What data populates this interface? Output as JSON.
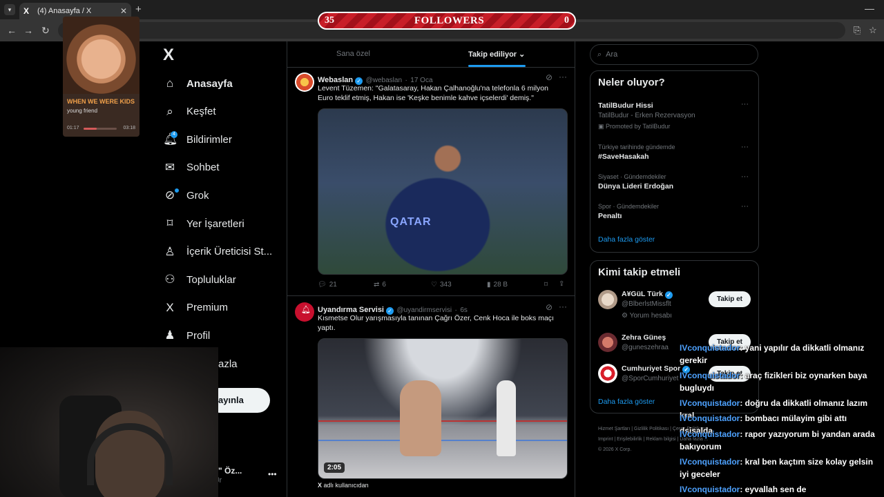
{
  "browser": {
    "tab_title": "(4) Anasayfa / X",
    "tab_favicon": "X",
    "tab_close": "✕",
    "new_tab": "+",
    "minimize": "—"
  },
  "followers_bar": {
    "left_count": "35",
    "label": "FOLLOWERS",
    "right_count": "0"
  },
  "music": {
    "song": "WHEN WE WERE KIDS",
    "artist": "young friend",
    "elapsed": "01:17",
    "total": "03:18",
    "progress": 0.39
  },
  "nav": {
    "logo": "X",
    "items": [
      {
        "label": "Anasayfa",
        "icon": "home-icon"
      },
      {
        "label": "Keşfet",
        "icon": "search-icon"
      },
      {
        "label": "Bildirimler",
        "icon": "bell-icon"
      },
      {
        "label": "Sohbet",
        "icon": "mail-icon"
      },
      {
        "label": "Grok",
        "icon": "grok-icon"
      },
      {
        "label": "Yer İşaretleri",
        "icon": "bookmark-icon"
      },
      {
        "label": "İçerik Üreticisi St...",
        "icon": "creator-icon"
      },
      {
        "label": "Topluluklar",
        "icon": "communities-icon"
      },
      {
        "label": "Premium",
        "icon": "x-icon"
      },
      {
        "label": "Profil",
        "icon": "profile-icon"
      },
      {
        "label": "azla",
        "icon": "more-icon"
      }
    ],
    "notification_count": "4",
    "post_button": "ayınla",
    "account_name": "elario\" Öz...",
    "account_handle": "Jr",
    "account_more": "•••"
  },
  "timeline": {
    "tabs": [
      "Sana özel",
      "Takip ediliyor"
    ],
    "active_tab": "Takip ediliyor",
    "posts": [
      {
        "name": "Webaslan",
        "handle": "@webaslan",
        "date": "17 Oca",
        "text": "Levent Tüzemen: \"Galatasaray, Hakan Çalhanoğlu'na telefonla 6 milyon Euro teklif etmiş, Hakan ise 'Keşke benimle kahve içselerdi' demiş.\"",
        "image_text": "QATAR",
        "replies": "21",
        "reposts": "6",
        "likes": "343",
        "views": "28 B"
      },
      {
        "name": "Uyandırma Servisi",
        "handle": "@uyandirmservisi",
        "date": "6s",
        "text": "Kısmetse Olur yarışmasıyla tanınan Çağrı Özer, Cenk Hoca ile boks maçı yaptı.",
        "video_duration": "2:05",
        "caption_prefix": "X",
        "caption": "adlı kullanıcıdan"
      }
    ]
  },
  "sidebar": {
    "search_placeholder": "Ara",
    "trends_title": "Neler oluyor?",
    "trends": [
      {
        "meta": "",
        "name": "TatilBudur Hissi",
        "sub": "TatilBudur - Erken Rezervasyon",
        "promo": "Promoted by TatilBudur"
      },
      {
        "meta": "Türkiye tarihinde gündemde",
        "name": "#SaveHasakah"
      },
      {
        "meta": "Siyaset · Gündemdekiler",
        "name": "Dünya Lideri Erdoğan"
      },
      {
        "meta": "Spor · Gündemdekiler",
        "name": "Penaltı"
      }
    ],
    "show_more": "Daha fazla göster",
    "who_title": "Kimi takip etmeli",
    "who": [
      {
        "name": "A¥GüL Türk",
        "handle": "@BlberlstMissflt",
        "extra": "Yorum hesabı",
        "button": "Takip et"
      },
      {
        "name": "Zehra Güneş",
        "handle": "@guneszehraa",
        "button": "Takip et"
      },
      {
        "name": "Cumhuriyet Spor",
        "handle": "@SporCumhuriyet",
        "button": "Takip et"
      }
    ],
    "who_more": "Daha fazla göster",
    "footer": [
      "Hizmet Şartları",
      "Gizlilik Politikası",
      "Çerez Politikası",
      "Imprint",
      "Erişilebilirlik",
      "Reklam bilgisi",
      "Daha fazla ...",
      "© 2026 X Corp."
    ]
  },
  "chat": [
    {
      "user": "IVconquistador",
      "msg": ": yani yapılır da dikkatli olmanız gerekir"
    },
    {
      "user": "IVconquistador",
      "msg": ": araç fizikleri biz oynarken baya bugluydı"
    },
    {
      "user": "IVconquistador",
      "msg": ": doğru da dikkatli olmanız lazım kral"
    },
    {
      "user": "IVconquistador",
      "msg": ": bombacı mülayim gibi attı dşisalda"
    },
    {
      "user": "IVconquistador",
      "msg": ": rapor yazıyorum bi yandan arada bakıyorum"
    },
    {
      "user": "IVconquistador",
      "msg": ": kral ben kaçtım size kolay gelsin iyi geceler"
    },
    {
      "user": "IVconquistador",
      "msg": ": eyvallah sen de"
    }
  ],
  "colors": {
    "accent": "#1d9bf0",
    "bar_red": "#c81e28",
    "chat_user": "#4ea2ff"
  }
}
